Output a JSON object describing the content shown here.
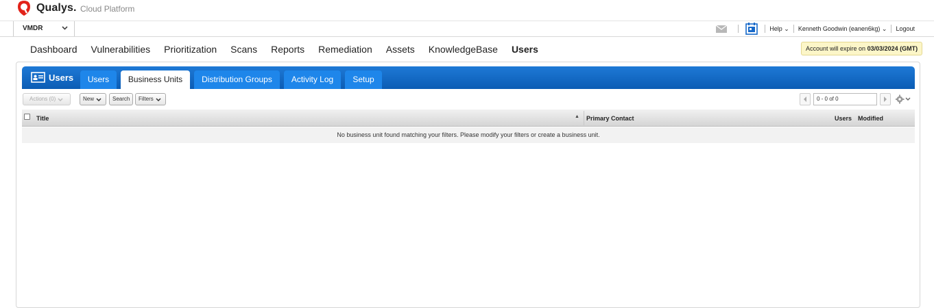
{
  "brand": {
    "name": "Qualys.",
    "sub": "Cloud Platform",
    "color": "#e2231a"
  },
  "module": {
    "label": "VMDR"
  },
  "header_tools": {
    "help": "Help",
    "user": "Kenneth Goodwin (eanen6kg)",
    "logout": "Logout"
  },
  "nav": {
    "items": [
      "Dashboard",
      "Vulnerabilities",
      "Prioritization",
      "Scans",
      "Reports",
      "Remediation",
      "Assets",
      "KnowledgeBase",
      "Users"
    ],
    "active": "Users"
  },
  "expire": {
    "prefix": "Account will expire on",
    "date": "03/03/2024 (GMT)"
  },
  "app": {
    "title": "Users"
  },
  "tabs": [
    "Users",
    "Business Units",
    "Distribution Groups",
    "Activity Log",
    "Setup"
  ],
  "active_tab": "Business Units",
  "toolbar": {
    "actions": "Actions (0)",
    "new": "New",
    "search": "Search",
    "filters": "Filters"
  },
  "pager": {
    "range": "0 - 0 of 0"
  },
  "table": {
    "columns": [
      "Title",
      "Primary Contact",
      "Users",
      "Modified"
    ],
    "empty_message": "No business unit found matching your filters. Please modify your filters or create a business unit."
  },
  "colors": {
    "tab_bar": "#1769c9",
    "tab": "#1e86ea",
    "accent_red": "#e2231a"
  }
}
